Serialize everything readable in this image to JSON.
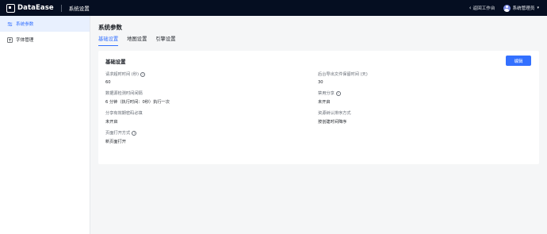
{
  "topbar": {
    "brand": "DataEase",
    "section": "系统设置",
    "back_label": "返回工作台",
    "user_label": "系统管理员"
  },
  "sidebar": {
    "items": [
      {
        "label": "系统参数",
        "active": true
      },
      {
        "label": "字体管理",
        "active": false
      }
    ]
  },
  "main": {
    "title": "系统参数",
    "tabs": [
      {
        "label": "基础设置",
        "active": true
      },
      {
        "label": "地图设置",
        "active": false
      },
      {
        "label": "引擎设置",
        "active": false
      }
    ],
    "card": {
      "title": "基础设置",
      "edit_label": "编辑",
      "fields": [
        {
          "label": "请求超时时间 (秒)",
          "value": "60",
          "info": true
        },
        {
          "label": "数据源检测时间间隔",
          "value": "6 分钟（执行时间：0秒）执行一次",
          "info": false
        },
        {
          "label": "分享有效期密码必填",
          "value": "未开启",
          "info": false
        },
        {
          "label": "页面打开方式",
          "value": "新页面打开",
          "info": true
        },
        {
          "label": "后台导出文件保留时间 (天)",
          "value": "30",
          "info": false
        },
        {
          "label": "禁用分享",
          "value": "未开启",
          "info": true
        },
        {
          "label": "资源树认排序方式",
          "value": "按创建时间降序",
          "info": false
        }
      ]
    }
  },
  "colors": {
    "topbar_bg": "#050e21",
    "accent": "#3370ff",
    "page_bg": "#f5f6f7"
  }
}
